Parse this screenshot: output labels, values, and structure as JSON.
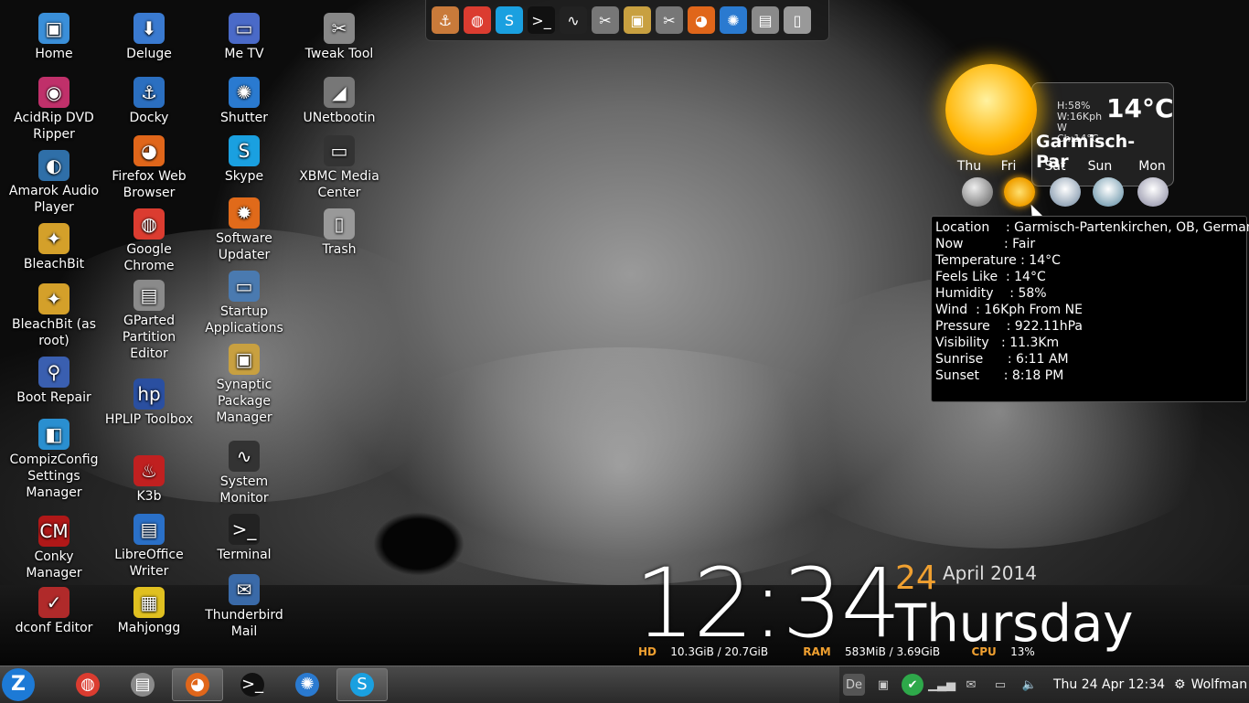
{
  "desktop_icons": [
    {
      "label": "Home",
      "glyph": "▣",
      "color": "#3a8fd9",
      "icon": "folder-home-icon"
    },
    {
      "label": "AcidRip DVD Ripper",
      "glyph": "◉",
      "color": "#c0306a",
      "icon": "dvd-icon"
    },
    {
      "label": "Amarok Audio Player",
      "glyph": "◐",
      "color": "#2f6fa8",
      "icon": "amarok-icon"
    },
    {
      "label": "BleachBit",
      "glyph": "✦",
      "color": "#d4a02a",
      "icon": "bleachbit-icon"
    },
    {
      "label": "BleachBit (as root)",
      "glyph": "✦",
      "color": "#d4a02a",
      "icon": "bleachbit-root-icon"
    },
    {
      "label": "Boot Repair",
      "glyph": "⚲",
      "color": "#3a5fb0",
      "icon": "boot-repair-icon"
    },
    {
      "label": "CompizConfig Settings Manager",
      "glyph": "◧",
      "color": "#2a8fd0",
      "icon": "compiz-icon"
    },
    {
      "label": "Conky Manager",
      "glyph": "CM",
      "color": "#b01818",
      "icon": "conky-icon"
    },
    {
      "label": "dconf Editor",
      "glyph": "✓",
      "color": "#b02a2a",
      "icon": "dconf-icon"
    },
    {
      "label": "Deluge",
      "glyph": "⬇",
      "color": "#3a7ad0",
      "icon": "deluge-icon"
    },
    {
      "label": "Docky",
      "glyph": "⚓",
      "color": "#2b6fc0",
      "icon": "docky-icon"
    },
    {
      "label": "Firefox Web Browser",
      "glyph": "◕",
      "color": "#e0661a",
      "icon": "firefox-icon"
    },
    {
      "label": "Google Chrome",
      "glyph": "◍",
      "color": "#db3c30",
      "icon": "chrome-icon"
    },
    {
      "label": "GParted Partition Editor",
      "glyph": "▤",
      "color": "#8a8a8a",
      "icon": "gparted-icon"
    },
    {
      "label": "HPLIP Toolbox",
      "glyph": "hp",
      "color": "#2a4fa0",
      "icon": "hplip-icon"
    },
    {
      "label": "K3b",
      "glyph": "♨",
      "color": "#c02020",
      "icon": "k3b-icon"
    },
    {
      "label": "LibreOffice Writer",
      "glyph": "▤",
      "color": "#2a70c8",
      "icon": "writer-icon"
    },
    {
      "label": "Mahjongg",
      "glyph": "▦",
      "color": "#e0c020",
      "icon": "mahjongg-icon"
    },
    {
      "label": "Me TV",
      "glyph": "▭",
      "color": "#4a6ac8",
      "icon": "tv-icon"
    },
    {
      "label": "Shutter",
      "glyph": "✺",
      "color": "#2a7ad0",
      "icon": "shutter-icon"
    },
    {
      "label": "Skype",
      "glyph": "S",
      "color": "#1aa0e0",
      "icon": "skype-icon"
    },
    {
      "label": "Software Updater",
      "glyph": "✹",
      "color": "#e06a1a",
      "icon": "updater-icon"
    },
    {
      "label": "Startup Applications",
      "glyph": "▭",
      "color": "#4a7ab0",
      "icon": "startup-icon"
    },
    {
      "label": "Synaptic Package Manager",
      "glyph": "▣",
      "color": "#c8a040",
      "icon": "synaptic-icon"
    },
    {
      "label": "System Monitor",
      "glyph": "∿",
      "color": "#333333",
      "icon": "system-monitor-icon"
    },
    {
      "label": "Terminal",
      "glyph": ">_",
      "color": "#222222",
      "icon": "terminal-icon"
    },
    {
      "label": "Thunderbird Mail",
      "glyph": "✉",
      "color": "#3a6aa8",
      "icon": "thunderbird-icon"
    },
    {
      "label": "Tweak Tool",
      "glyph": "✂",
      "color": "#888888",
      "icon": "tweak-tool-icon"
    },
    {
      "label": "UNetbootin",
      "glyph": "◢",
      "color": "#777777",
      "icon": "unetbootin-icon"
    },
    {
      "label": "XBMC Media Center",
      "glyph": "▭",
      "color": "#333333",
      "icon": "xbmc-icon"
    },
    {
      "label": "Trash",
      "glyph": "▯",
      "color": "#999999",
      "icon": "trash-icon"
    }
  ],
  "dock_items": [
    {
      "icon": "docky-icon",
      "glyph": "⚓",
      "color": "#c97a3a"
    },
    {
      "icon": "chrome-icon",
      "glyph": "◍",
      "color": "#db3c30"
    },
    {
      "icon": "skype-icon",
      "glyph": "S",
      "color": "#1aa0e0"
    },
    {
      "icon": "terminal-icon",
      "glyph": ">_",
      "color": "#111111"
    },
    {
      "icon": "system-monitor-icon",
      "glyph": "∿",
      "color": "#222222"
    },
    {
      "icon": "tweak-tool-icon",
      "glyph": "✂",
      "color": "#777777"
    },
    {
      "icon": "synaptic-icon",
      "glyph": "▣",
      "color": "#c8a040"
    },
    {
      "icon": "tweak-tool-2-icon",
      "glyph": "✂",
      "color": "#777777"
    },
    {
      "icon": "firefox-icon",
      "glyph": "◕",
      "color": "#e0661a"
    },
    {
      "icon": "shutter-icon",
      "glyph": "✺",
      "color": "#2a7ad0"
    },
    {
      "icon": "gparted-icon",
      "glyph": "▤",
      "color": "#8a8a8a"
    },
    {
      "icon": "trash-icon",
      "glyph": "▯",
      "color": "#999999"
    }
  ],
  "weather": {
    "humidity_short": "H:58%",
    "wind_short": "W:16Kph",
    "windchill_short": "W Ch:14°C",
    "temp": "14°C",
    "location_short": "Garmisch-Par",
    "days": [
      "Thu",
      "Fri",
      "Sat",
      "Sun",
      "Mon"
    ]
  },
  "tooltip": [
    "Location    : Garmisch-Partenkirchen, OB, Germany",
    "Now          : Fair",
    "Temperature : 14°C",
    "Feels Like  : 14°C",
    "Humidity    : 58%",
    "Wind  : 16Kph From NE",
    "Pressure    : 922.11hPa",
    "Visibility   : 11.3Km",
    "Sunrise      : 6:11 AM",
    "Sunset      : 8:18 PM"
  ],
  "clock": {
    "time": "12:34",
    "day_num": "24",
    "month_year": "April 2014",
    "weekday": "Thursday",
    "hd_label": "HD",
    "hd_value": "10.3GiB / 20.7GiB",
    "ram_label": "RAM",
    "ram_value": "583MiB / 3.69GiB",
    "cpu_label": "CPU",
    "cpu_value": "13%"
  },
  "taskbar": {
    "menu_glyph": "Z",
    "tasks": [
      {
        "icon": "chrome-icon",
        "glyph": "◍",
        "color": "#db3c30",
        "active": false
      },
      {
        "icon": "gparted-icon",
        "glyph": "▤",
        "color": "#8a8a8a",
        "active": false
      },
      {
        "icon": "firefox-icon",
        "glyph": "◕",
        "color": "#e0661a",
        "active": true
      },
      {
        "icon": "terminal-icon",
        "glyph": ">_",
        "color": "#111111",
        "active": false
      },
      {
        "icon": "shutter-icon",
        "glyph": "✺",
        "color": "#2a7ad0",
        "active": false
      },
      {
        "icon": "skype-icon",
        "glyph": "S",
        "color": "#1aa0e0",
        "active": true
      }
    ],
    "tray_icons": [
      {
        "icon": "keyboard-layout-icon",
        "glyph": "De"
      },
      {
        "icon": "gamepad-icon",
        "glyph": "▣"
      },
      {
        "icon": "check-icon",
        "glyph": "✔"
      },
      {
        "icon": "network-signal-icon",
        "glyph": "▁▃▅"
      },
      {
        "icon": "mail-icon",
        "glyph": "✉"
      },
      {
        "icon": "battery-icon",
        "glyph": "▭"
      },
      {
        "icon": "volume-icon",
        "glyph": "🔈"
      }
    ],
    "datetime": "Thu 24 Apr  12:34",
    "user_icon": "⚙",
    "user": "Wolfman"
  }
}
